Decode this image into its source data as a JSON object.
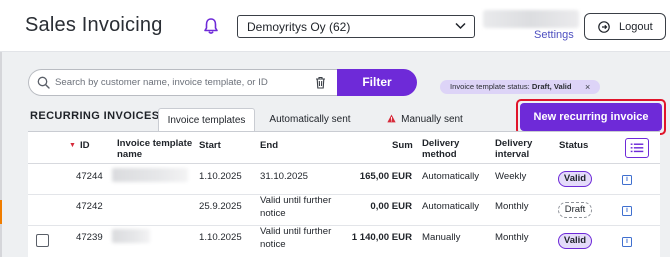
{
  "header": {
    "app_title": "Sales Invoicing",
    "company": "Demoyritys Oy (62)",
    "settings_label": "Settings",
    "logout_label": "Logout"
  },
  "filters": {
    "search_placeholder": "Search by customer name, invoice template, or ID",
    "filter_label": "Filter",
    "active_chip_prefix": "Invoice template status: ",
    "active_chip_value": "Draft, Valid",
    "chip_remove": "×"
  },
  "section": {
    "title": "RECURRING INVOICES",
    "tabs": [
      {
        "label": "Invoice templates",
        "active": true
      },
      {
        "label": "Automatically sent",
        "active": false
      },
      {
        "label": "Manually sent",
        "active": false
      }
    ],
    "new_button_label": "New recurring invoice"
  },
  "table": {
    "columns": {
      "id": "ID",
      "name": "Invoice template name",
      "start": "Start",
      "end": "End",
      "sum": "Sum",
      "delivery_method": "Delivery method",
      "delivery_interval": "Delivery interval",
      "status": "Status"
    },
    "rows": [
      {
        "id": "47244",
        "start": "1.10.2025",
        "end": "31.10.2025",
        "sum": "165,00 EUR",
        "method": "Automatically",
        "interval": "Weekly",
        "status": "Valid"
      },
      {
        "id": "47242",
        "start": "25.9.2025",
        "end": "Valid until further notice",
        "sum": "0,00 EUR",
        "method": "Automatically",
        "interval": "Monthly",
        "status": "Draft"
      },
      {
        "id": "47239",
        "start": "1.10.2025",
        "end": "Valid until further notice",
        "sum": "1 140,00 EUR",
        "method": "Manually",
        "interval": "Monthly",
        "status": "Valid"
      }
    ]
  },
  "colors": {
    "accent": "#6e2ad8",
    "highlight_border": "#e0142a",
    "chip_bg": "#ddd4f7"
  }
}
